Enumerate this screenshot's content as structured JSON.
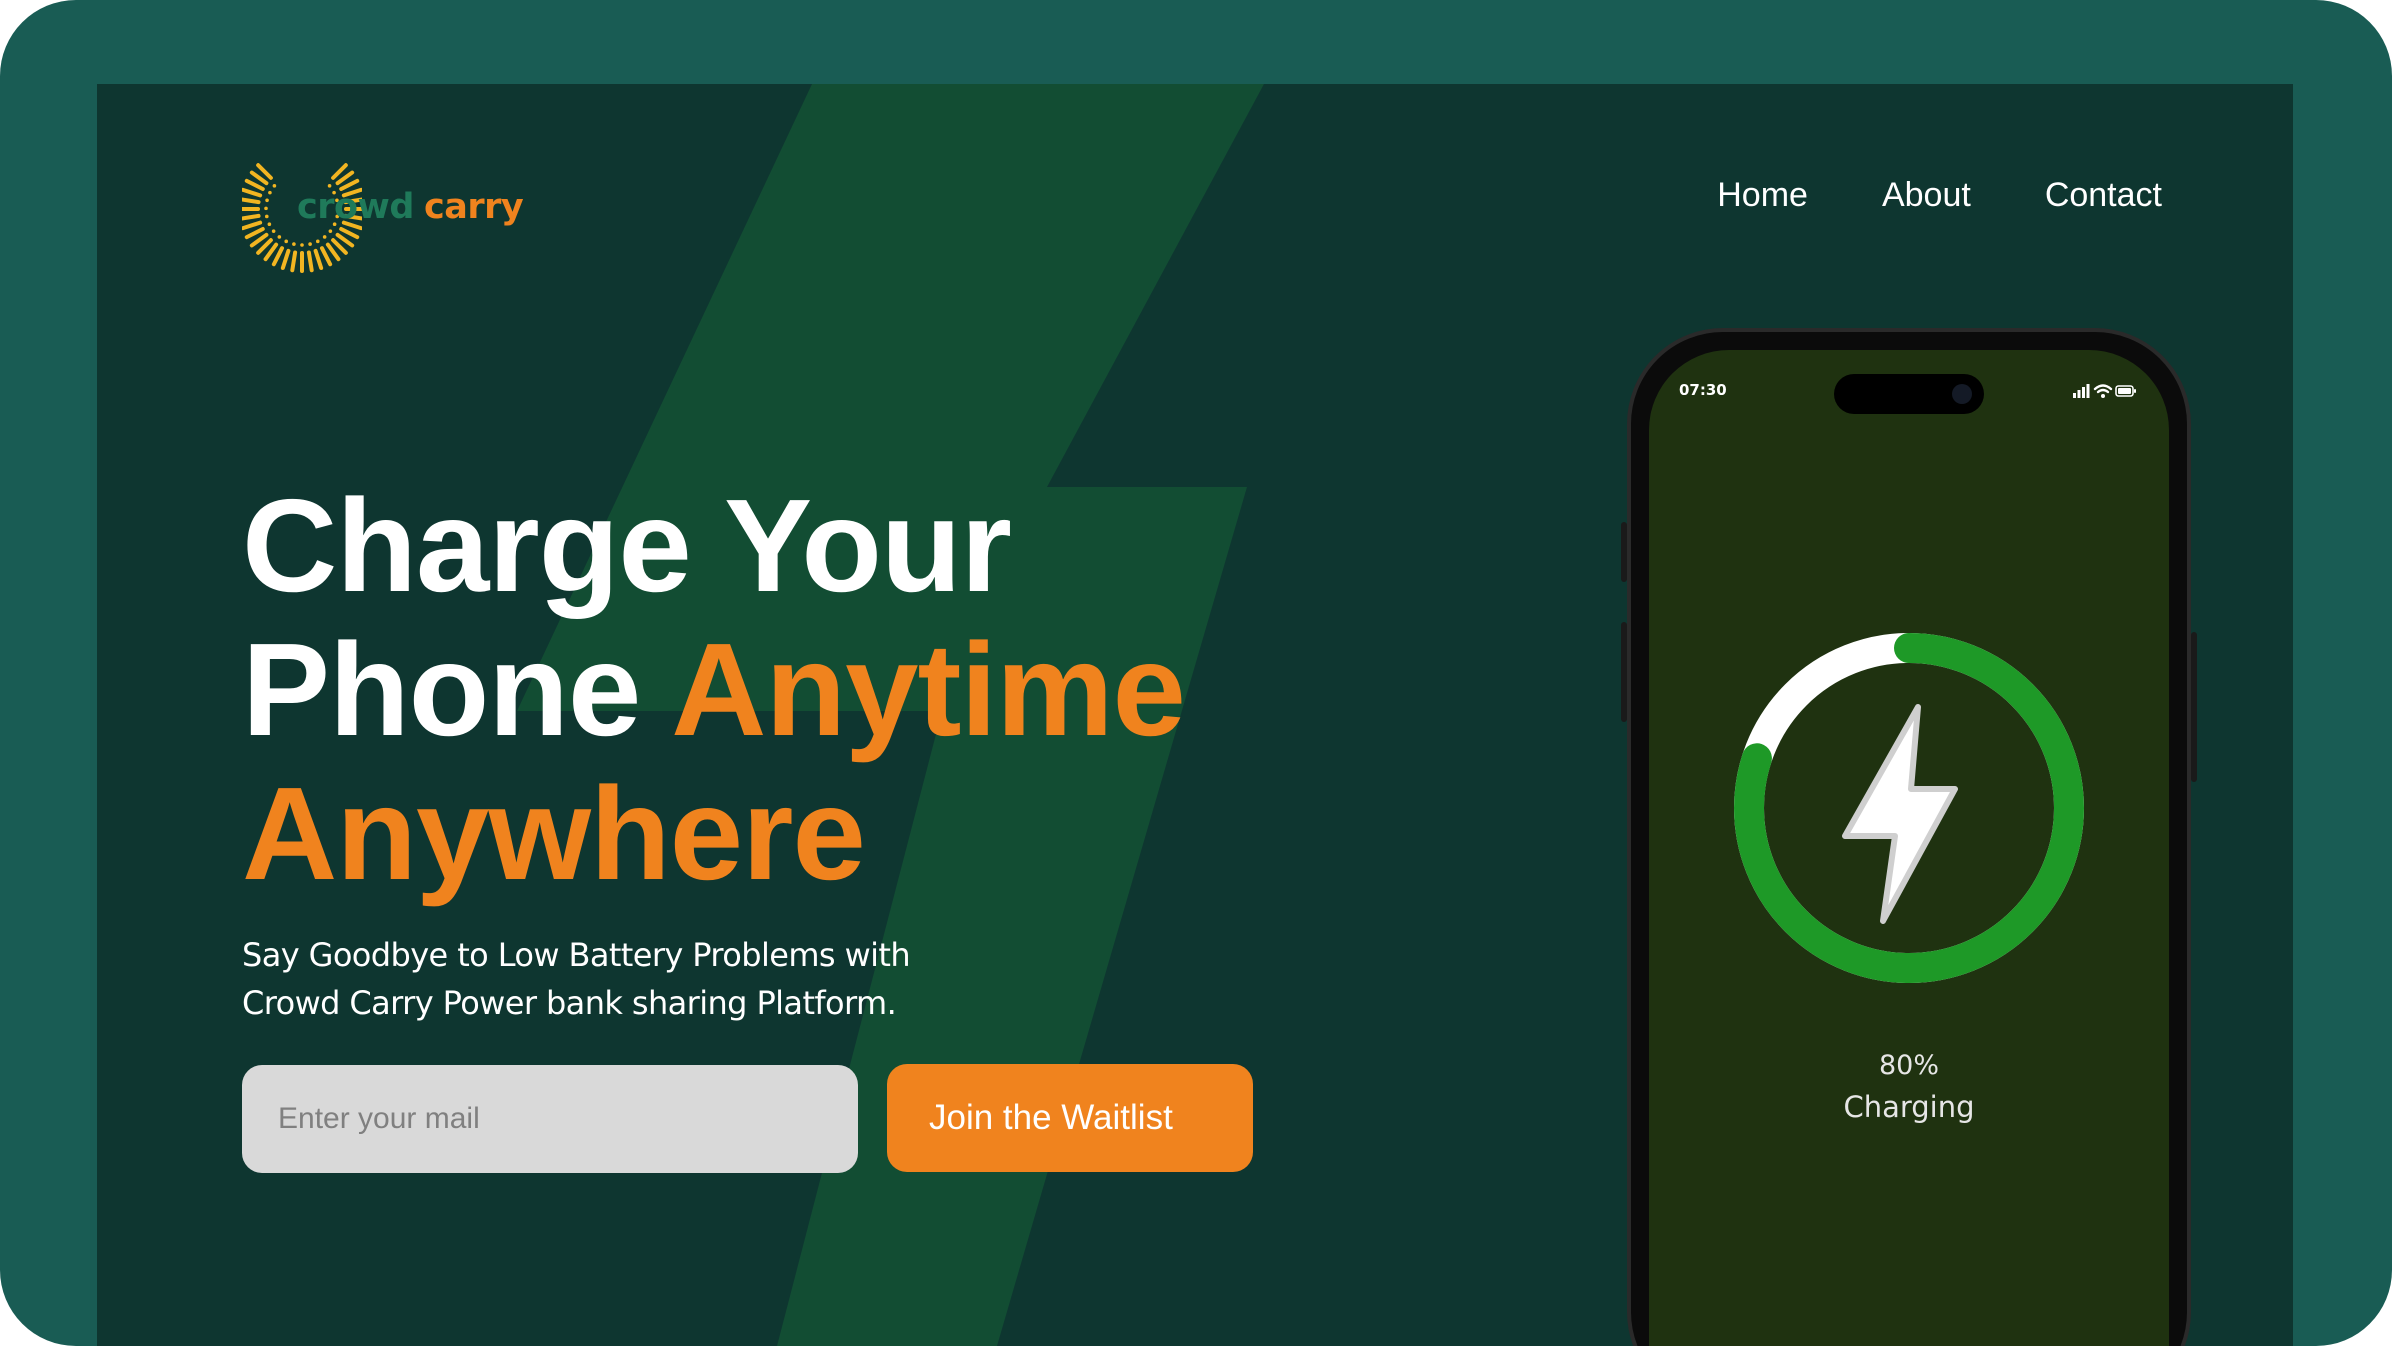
{
  "brand": {
    "name_part1": "crowd",
    "name_part2": "carry",
    "logo_icon": "sunburst-c-icon",
    "colors": {
      "teal": "#1f7a5a",
      "orange": "#f0831e",
      "gold": "#f2b521"
    }
  },
  "nav": {
    "items": [
      {
        "label": "Home"
      },
      {
        "label": "About"
      },
      {
        "label": "Contact"
      }
    ]
  },
  "hero": {
    "line1": "Charge Your",
    "line2_white": "Phone",
    "line2_orange": "Anytime",
    "line3_orange": "Anywhere",
    "subtitle_line1": "Say Goodbye to Low Battery Problems with",
    "subtitle_line2": "Crowd Carry Power bank sharing Platform.",
    "email_placeholder": "Enter your mail",
    "cta_label": "Join the Waitlist"
  },
  "phone": {
    "time": "07:30",
    "status_icons": [
      "signal-icon",
      "wifi-icon",
      "battery-icon"
    ],
    "charge_percent_text": "80%",
    "charge_fraction": 0.8,
    "charge_label": "Charging",
    "center_icon": "lightning-bolt-icon"
  },
  "theme": {
    "background": "#0e3630",
    "frame": "#195c54",
    "bolt_shape": "#124d33",
    "accent": "#f0831e",
    "ring_progress": "#1e9927",
    "ring_track": "#ffffff",
    "screen": "#1f3210"
  }
}
